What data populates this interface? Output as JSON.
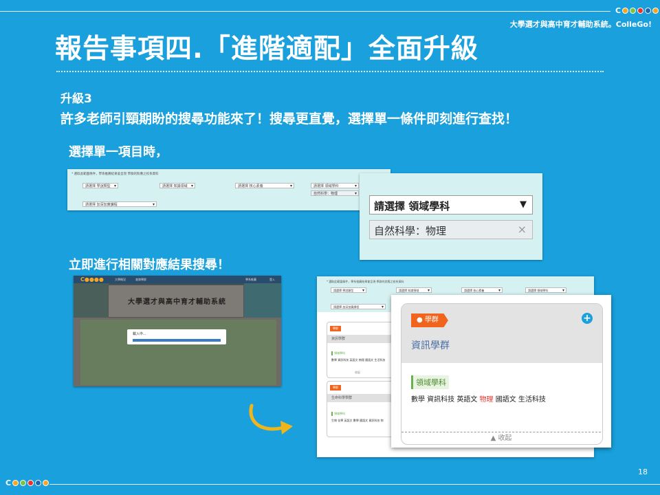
{
  "header": {
    "system_name": "大學選才與高中育才輔助系統。ColleGo!",
    "title": "報告事項四.「進階適配」全面升級"
  },
  "intro": {
    "upgrade_label": "升級3",
    "description": "許多老師引頸期盼的搜尋功能來了！搜尋更直覺，選擇單一條件即刻進行查找！"
  },
  "section1": {
    "heading": "選擇單一項目時，",
    "filter_panel": {
      "note": "* 選取此範圍條件，學系推薦結果會呈現 學群的對應之校系資料",
      "selects": [
        "請選擇 學說類型",
        "請選擇 知識領域",
        "請選擇 核心素養",
        "請選擇 領域學科",
        "請選擇 加深加廣課程"
      ],
      "chip": "自然科學：物理"
    },
    "zoom": {
      "select_label": "請選擇 領域學科",
      "chip_label": "自然科學：物理",
      "chip_close": "×"
    }
  },
  "section2": {
    "heading": "立即進行相關對應結果搜尋！",
    "site": {
      "nav": [
        "大學概況",
        "查詢學群",
        "學系推薦",
        "登入"
      ],
      "banner_title": "大學選才與高中育才輔助系統",
      "loading_text": "載入中..."
    },
    "results_panel": {
      "note": "* 選取此範圍條件，學系推薦結果會呈現 學群的對應之校系資料",
      "selects": [
        "請選擇 學說類型",
        "請選擇 知識領域",
        "請選擇 核心素養",
        "請選擇 領域學科",
        "請選擇 加深加廣課程"
      ],
      "cards": [
        {
          "tag": "學群",
          "name": "資訊學群",
          "area": "領域學科",
          "subjects": "數學 資訊科技 英語文 物理 國語文 生活科技",
          "toggle": "收起"
        },
        {
          "tag": "學群",
          "name": "生命科學學群",
          "area": "領域學科",
          "subjects": "生物 化學 英語文 數學 國語文 資訊科技 物",
          "toggle": "收起"
        }
      ]
    },
    "zoom_card": {
      "tag": "學群",
      "name": "資訊學群",
      "area": "領域學科",
      "subjects_before": "數學 資訊科技 英語文 ",
      "subject_highlight": "物理",
      "subjects_after": " 國語文 生活科技",
      "toggle": "收起",
      "add_icon": "plus-circle-icon"
    }
  },
  "footer": {
    "page_number": "18"
  },
  "colors": {
    "background": "#1aa0dc",
    "accent": "#f0641e",
    "highlight": "#e8322d",
    "green": "#6ab04c",
    "arrow": "#f1b51c"
  }
}
